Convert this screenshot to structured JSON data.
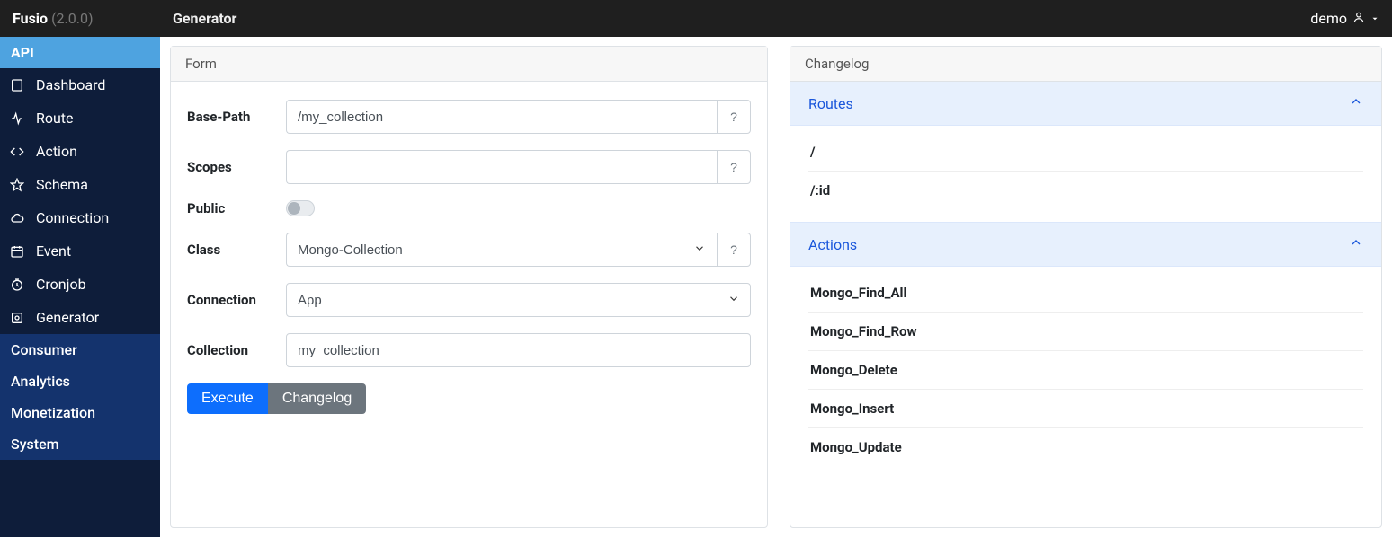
{
  "brand": {
    "name": "Fusio",
    "version": "(2.0.0)"
  },
  "page_title": "Generator",
  "user": {
    "name": "demo"
  },
  "sidebar": {
    "groups": [
      {
        "label": "API",
        "active": true,
        "items": [
          {
            "label": "Dashboard",
            "icon": "dashboard-icon"
          },
          {
            "label": "Route",
            "icon": "route-icon"
          },
          {
            "label": "Action",
            "icon": "code-icon"
          },
          {
            "label": "Schema",
            "icon": "star-icon"
          },
          {
            "label": "Connection",
            "icon": "cloud-icon"
          },
          {
            "label": "Event",
            "icon": "calendar-icon"
          },
          {
            "label": "Cronjob",
            "icon": "clock-icon"
          },
          {
            "label": "Generator",
            "icon": "generator-icon"
          }
        ]
      },
      {
        "label": "Consumer"
      },
      {
        "label": "Analytics"
      },
      {
        "label": "Monetization"
      },
      {
        "label": "System"
      }
    ]
  },
  "form": {
    "panel_title": "Form",
    "base_path_label": "Base-Path",
    "base_path_value": "/my_collection",
    "scopes_label": "Scopes",
    "scopes_value": "",
    "public_label": "Public",
    "public_value": false,
    "class_label": "Class",
    "class_value": "Mongo-Collection",
    "connection_label": "Connection",
    "connection_value": "App",
    "collection_label": "Collection",
    "collection_value": "my_collection",
    "help": "?",
    "buttons": {
      "execute": "Execute",
      "changelog": "Changelog"
    }
  },
  "changelog": {
    "panel_title": "Changelog",
    "sections": [
      {
        "title": "Routes",
        "items": [
          "/",
          "/:id"
        ]
      },
      {
        "title": "Actions",
        "items": [
          "Mongo_Find_All",
          "Mongo_Find_Row",
          "Mongo_Delete",
          "Mongo_Insert",
          "Mongo_Update"
        ]
      }
    ]
  }
}
